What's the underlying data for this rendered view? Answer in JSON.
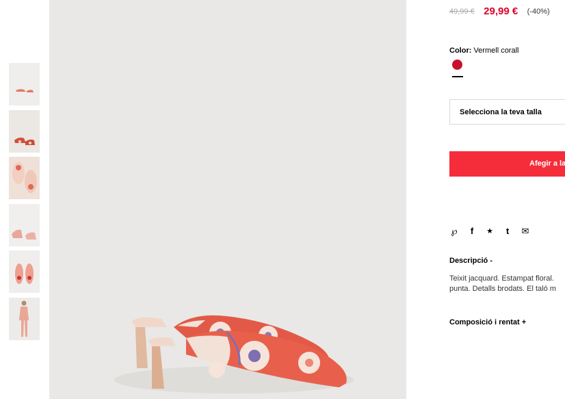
{
  "product": {
    "old_price": "49,99 €",
    "new_price": "29,99 €",
    "discount": "(-40%)",
    "color_label": "Color:",
    "color_value": "Vermell corall",
    "size_placeholder": "Selecciona la teva talla",
    "add_button": "Afegir a la",
    "description_title": "Descripció  -",
    "description_lines": [
      "Teixit jacquard. Estampat floral.",
      "punta. Detalls brodats. El taló m"
    ],
    "composition_title": "Composició i rentat  +"
  },
  "share": {
    "pinterest": "℘",
    "facebook": "f",
    "twitter": "★",
    "tumblr": "t",
    "email": "✉"
  },
  "colors": {
    "price_red": "#e0002a",
    "swatch_red": "#c8102e",
    "button_red": "#f52c3a",
    "image_bg": "#e9e8e6"
  }
}
